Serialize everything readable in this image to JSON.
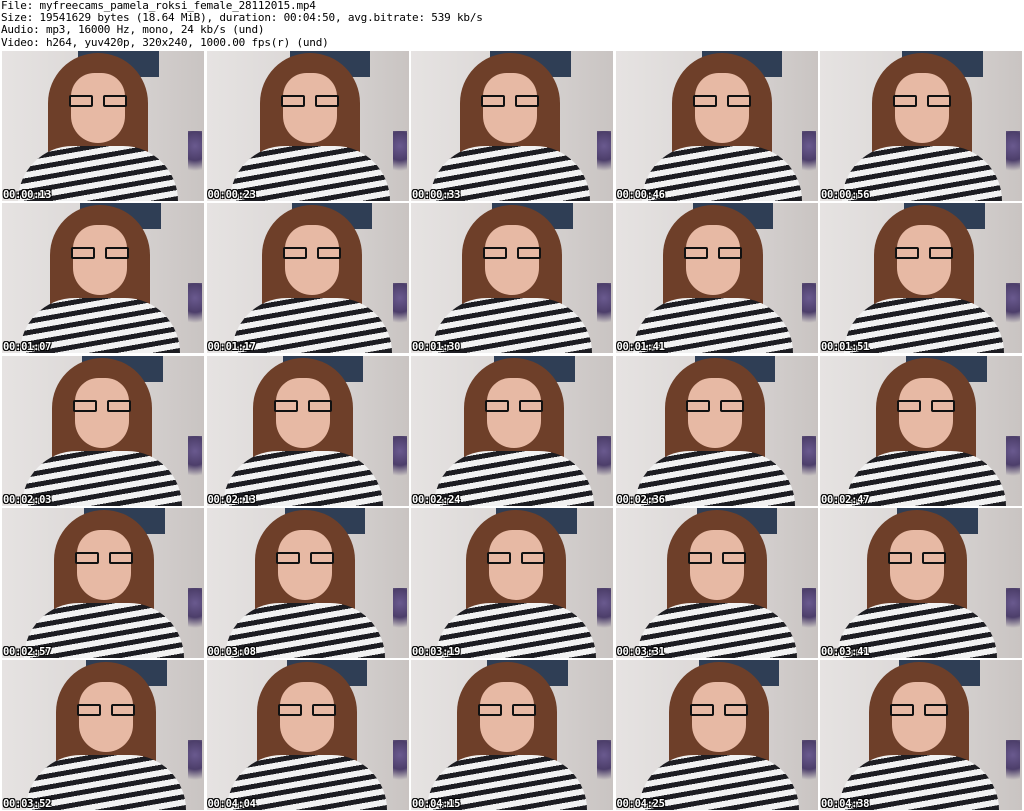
{
  "header": {
    "file_line": "File: myfreecams_pamela_roksi_female_28112015.mp4",
    "size_line": "Size: 19541629 bytes (18.64 MiB), duration: 00:04:50, avg.bitrate: 539 kb/s",
    "audio_line": "Audio: mp3, 16000 Hz, mono, 24 kb/s (und)",
    "video_line": "Video: h264, yuv420p, 320x240, 1000.00 fps(r) (und)"
  },
  "thumbnails": [
    {
      "timestamp": "00:00:13"
    },
    {
      "timestamp": "00:00:23"
    },
    {
      "timestamp": "00:00:33"
    },
    {
      "timestamp": "00:00:46"
    },
    {
      "timestamp": "00:00:56"
    },
    {
      "timestamp": "00:01:07"
    },
    {
      "timestamp": "00:01:17"
    },
    {
      "timestamp": "00:01:30"
    },
    {
      "timestamp": "00:01:41"
    },
    {
      "timestamp": "00:01:51"
    },
    {
      "timestamp": "00:02:03"
    },
    {
      "timestamp": "00:02:13"
    },
    {
      "timestamp": "00:02:24"
    },
    {
      "timestamp": "00:02:36"
    },
    {
      "timestamp": "00:02:47"
    },
    {
      "timestamp": "00:02:57"
    },
    {
      "timestamp": "00:03:08"
    },
    {
      "timestamp": "00:03:19"
    },
    {
      "timestamp": "00:03:31"
    },
    {
      "timestamp": "00:03:41"
    },
    {
      "timestamp": "00:03:52"
    },
    {
      "timestamp": "00:04:04"
    },
    {
      "timestamp": "00:04:15"
    },
    {
      "timestamp": "00:04:25"
    },
    {
      "timestamp": "00:04:38"
    }
  ]
}
